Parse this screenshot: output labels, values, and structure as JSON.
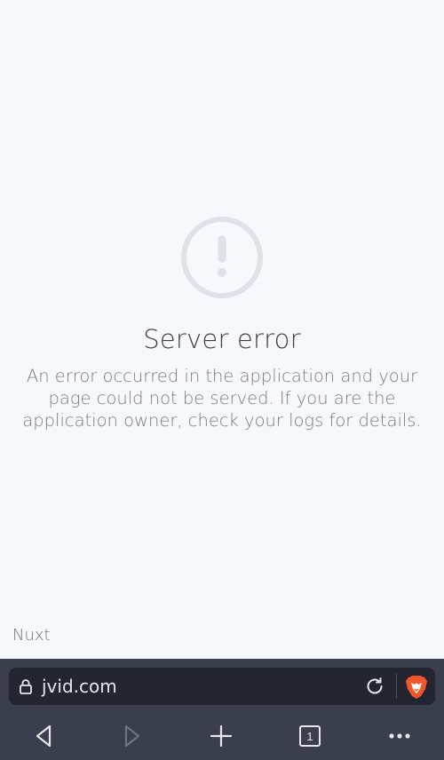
{
  "error": {
    "title": "Server error",
    "description": "An error occurred in the application and your page could not be served. If you are the application owner, check your logs for details.",
    "icon": "exclamation-circle-icon"
  },
  "footer": {
    "brand": "Nuxt"
  },
  "browser": {
    "url": "jvid.com",
    "tab_count": "1",
    "icons": [
      "lock-icon",
      "reload-icon",
      "brave-lion-icon",
      "back-icon",
      "forward-icon",
      "new-tab-icon",
      "tabs-icon",
      "more-icon"
    ]
  },
  "colors": {
    "page_bg": "#f7f8fb",
    "toolbar_bg": "#3b3e4c",
    "url_field_bg": "#232531",
    "brave_orange": "#f1562b"
  }
}
